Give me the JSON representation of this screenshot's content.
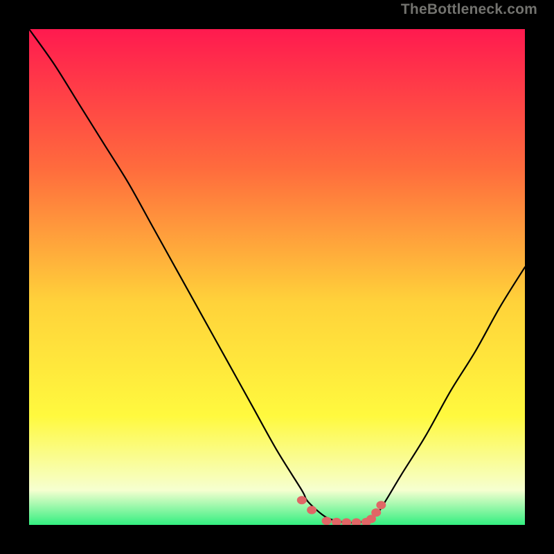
{
  "watermark": "TheBottleneck.com",
  "colors": {
    "bg": "#000000",
    "grad_top": "#ff1a4f",
    "grad_mid1": "#ff6b3d",
    "grad_mid2": "#ffd23a",
    "grad_mid3": "#fff93e",
    "grad_low": "#f6ffd0",
    "grad_bottom": "#33ef80",
    "curve": "#000000",
    "marker_fill": "#e06666",
    "marker_stroke": "#c14f4f"
  },
  "chart_data": {
    "type": "line",
    "title": "",
    "xlabel": "",
    "ylabel": "",
    "x": [
      0,
      5,
      10,
      15,
      20,
      25,
      30,
      35,
      40,
      45,
      50,
      55,
      56,
      58,
      60,
      62,
      64,
      66,
      68,
      70,
      72,
      75,
      80,
      85,
      90,
      95,
      100
    ],
    "values": [
      100,
      93,
      85,
      77,
      69,
      60,
      51,
      42,
      33,
      24,
      15,
      7,
      5,
      3,
      1.5,
      0.8,
      0.5,
      0.5,
      0.8,
      2,
      5,
      10,
      18,
      27,
      35,
      44,
      52
    ],
    "xlim": [
      0,
      100
    ],
    "ylim": [
      0,
      100
    ],
    "markers": {
      "x": [
        55,
        57,
        60,
        62,
        64,
        66,
        68,
        69,
        70,
        71
      ],
      "values": [
        5,
        3,
        0.8,
        0.6,
        0.5,
        0.5,
        0.6,
        1.2,
        2.5,
        4
      ]
    },
    "background_gradient": {
      "orientation": "vertical",
      "stops": [
        {
          "offset": 0.0,
          "color": "#ff1a4f"
        },
        {
          "offset": 0.28,
          "color": "#ff6b3d"
        },
        {
          "offset": 0.55,
          "color": "#ffd23a"
        },
        {
          "offset": 0.78,
          "color": "#fff93e"
        },
        {
          "offset": 0.93,
          "color": "#f6ffd0"
        },
        {
          "offset": 1.0,
          "color": "#33ef80"
        }
      ]
    }
  }
}
